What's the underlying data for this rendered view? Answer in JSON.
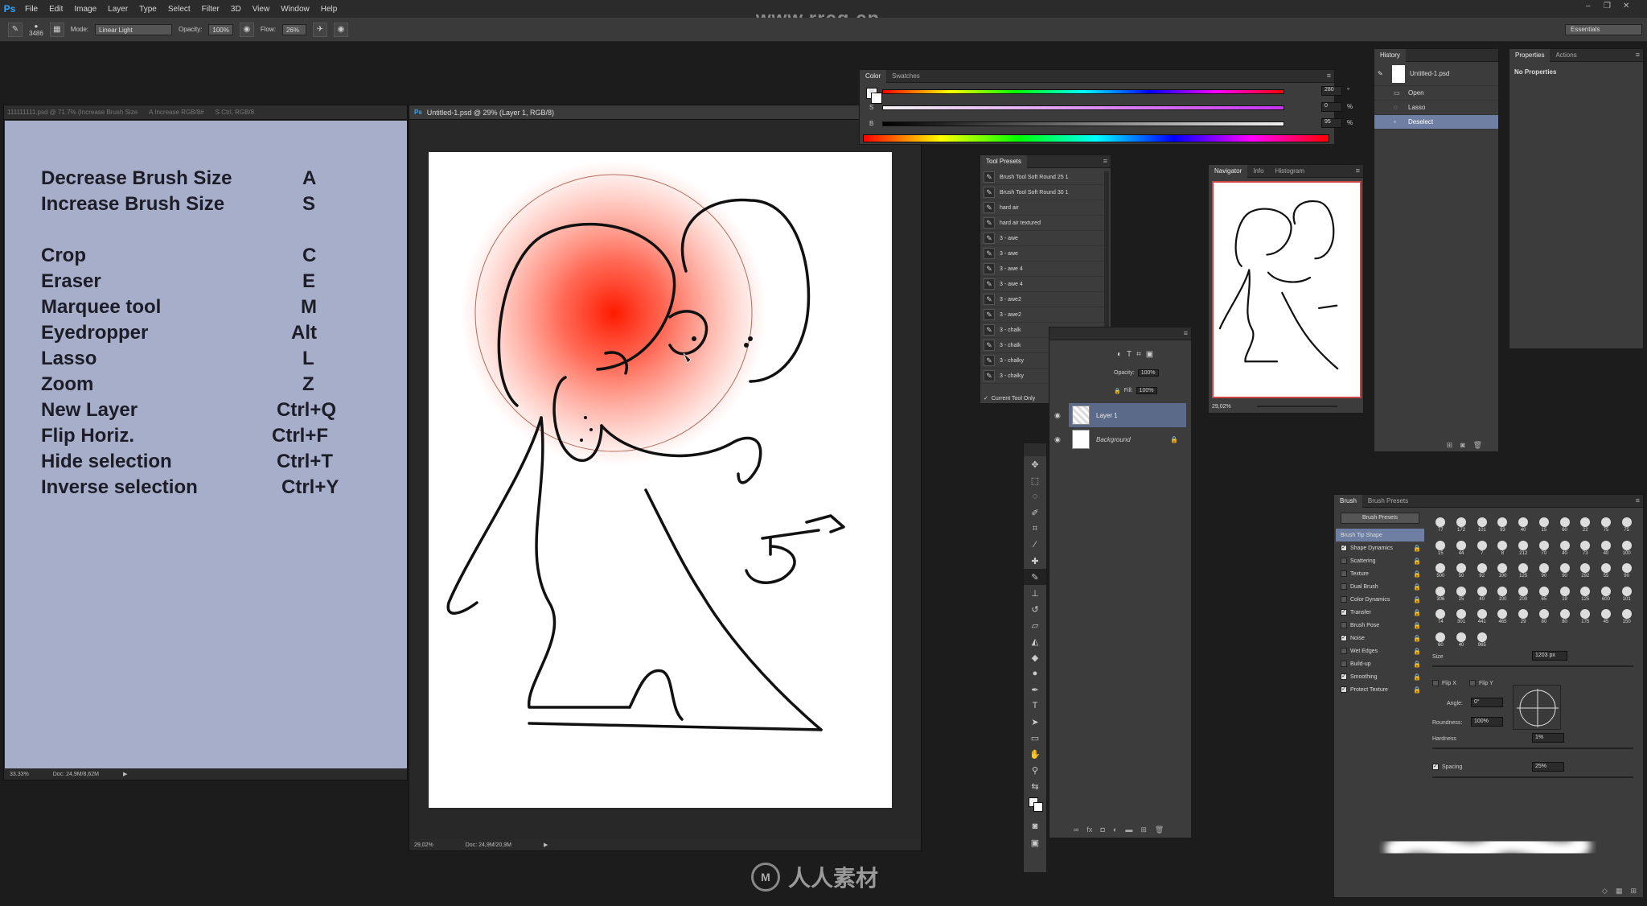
{
  "menubar": {
    "app_icon": "Ps",
    "items": [
      "File",
      "Edit",
      "Image",
      "Layer",
      "Type",
      "Select",
      "Filter",
      "3D",
      "View",
      "Window",
      "Help"
    ]
  },
  "options_bar": {
    "brush_size": "3486",
    "mode_label": "Mode:",
    "mode_value": "Linear Light",
    "opacity_label": "Opacity:",
    "opacity_value": "100%",
    "flow_label": "Flow:",
    "flow_value": "26%"
  },
  "watermark_url": "www.rrcg.cn",
  "workspace": "Essentials",
  "doc1": {
    "tab_title": "111111111.psd @ 71.7% (Increase Brush Size",
    "tab_title_2": "A Increase RGB/8#",
    "tab_title_3": "S Ctrl, RGB/8",
    "shortcuts": [
      {
        "action": "Decrease Brush Size",
        "key": "A"
      },
      {
        "action": "Increase Brush Size",
        "key": "S"
      },
      {
        "action": "Crop",
        "key": "C"
      },
      {
        "action": "Eraser",
        "key": "E"
      },
      {
        "action": "Marquee tool",
        "key": "M"
      },
      {
        "action": "Eyedropper",
        "key": "Alt"
      },
      {
        "action": "Lasso",
        "key": "L"
      },
      {
        "action": "Zoom",
        "key": "Z"
      },
      {
        "action": "New Layer",
        "key": "Ctrl+Q"
      },
      {
        "action": "Flip Horiz.",
        "key": "Ctrl+F"
      },
      {
        "action": "Hide selection",
        "key": "Ctrl+T"
      },
      {
        "action": "Inverse selection",
        "key": "Ctrl+Y"
      }
    ],
    "zoom": "33.33%",
    "doc_size": "Doc: 24,9M/8,62M"
  },
  "doc2": {
    "tab_title": "Untitled-1.psd @ 29% (Layer 1, RGB/8)",
    "zoom": "29,02%",
    "doc_size": "Doc: 24,9M/20,9M"
  },
  "color_panel": {
    "tabs": [
      "Color",
      "Swatches"
    ],
    "sliders": [
      {
        "label": "H",
        "value": "280",
        "unit": "°",
        "pos": 0.78
      },
      {
        "label": "S",
        "value": "0",
        "unit": "%",
        "pos": 0.0
      },
      {
        "label": "B",
        "value": "95",
        "unit": "%",
        "pos": 0.95
      }
    ]
  },
  "tool_presets": {
    "tab": "Tool Presets",
    "items": [
      "Brush Tool Soft Round 25 1",
      "Brush Tool Soft Round 30 1",
      "hard air",
      "hard air textured",
      "3 - awe",
      "3 - awe",
      "3 - awe 4",
      "3 - awe 4",
      "3 - awe2",
      "3 - awe2",
      "3 - chalk",
      "3 - chalk",
      "3 - chalky",
      "3 - chalky"
    ],
    "current_tool_only": "Current Tool Only"
  },
  "navigator": {
    "tabs": [
      "Navigator",
      "Info",
      "Histogram"
    ],
    "zoom": "29,02%"
  },
  "history": {
    "tab": "History",
    "snapshot": "Untitled-1.psd",
    "items": [
      "Open",
      "Lasso",
      "Deselect"
    ]
  },
  "properties": {
    "tabs": [
      "Properties",
      "Actions"
    ],
    "message": "No Properties"
  },
  "layers": {
    "opacity_label": "Opacity:",
    "opacity_value": "100%",
    "fill_label": "Fill:",
    "fill_value": "100%",
    "items": [
      "Layer 1",
      "Background"
    ]
  },
  "brush_panel": {
    "tabs": [
      "Brush",
      "Brush Presets"
    ],
    "presets_button": "Brush Presets",
    "options": [
      {
        "label": "Brush Tip Shape",
        "checked": null
      },
      {
        "label": "Shape Dynamics",
        "checked": true
      },
      {
        "label": "Scattering",
        "checked": false
      },
      {
        "label": "Texture",
        "checked": false
      },
      {
        "label": "Dual Brush",
        "checked": false
      },
      {
        "label": "Color Dynamics",
        "checked": false
      },
      {
        "label": "Transfer",
        "checked": true
      },
      {
        "label": "Brush Pose",
        "checked": false
      },
      {
        "label": "Noise",
        "checked": true
      },
      {
        "label": "Wet Edges",
        "checked": false
      },
      {
        "label": "Build-up",
        "checked": false
      },
      {
        "label": "Smoothing",
        "checked": true
      },
      {
        "label": "Protect Texture",
        "checked": true
      }
    ],
    "tips": [
      "77",
      "172",
      "101",
      "93",
      "40",
      "15",
      "60",
      "22",
      "75",
      "75",
      "15",
      "44",
      "7",
      "8",
      "212",
      "70",
      "40",
      "73",
      "40",
      "100",
      "500",
      "50",
      "92",
      "100",
      "125",
      "90",
      "90",
      "292",
      "55",
      "90",
      "306",
      "25",
      "40",
      "100",
      "200",
      "65",
      "19",
      "125",
      "600",
      "101",
      "74",
      "301",
      "441",
      "465",
      "29",
      "80",
      "80",
      "175",
      "45",
      "150",
      "60",
      "40",
      "965"
    ],
    "size_label": "Size",
    "size_value": "1203 px",
    "flip_x": "Flip X",
    "flip_y": "Flip Y",
    "angle_label": "Angle:",
    "angle_value": "0°",
    "roundness_label": "Roundness:",
    "roundness_value": "100%",
    "hardness_label": "Hardness",
    "hardness_value": "1%",
    "spacing_label": "Spacing",
    "spacing_value": "25%"
  },
  "bottom_logo": "人人素材"
}
